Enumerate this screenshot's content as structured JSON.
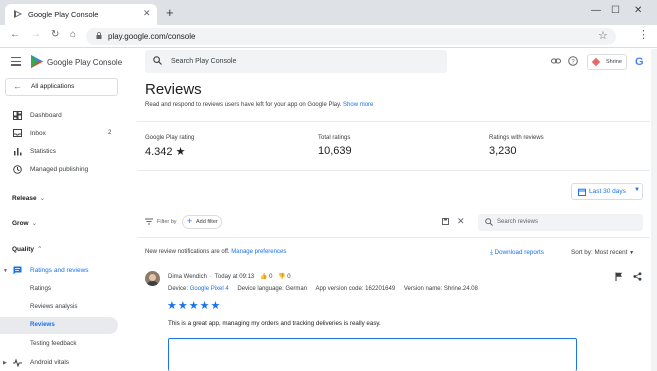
{
  "browser": {
    "tab_title": "Google Play Console",
    "url": "play.google.com/console"
  },
  "header": {
    "app_name": "Google Play Console",
    "search_placeholder": "Search Play Console",
    "app_chip": "Shrine",
    "google_logo": "G"
  },
  "sidebar": {
    "back_label": "All applications",
    "items": [
      {
        "label": "Dashboard",
        "icon": "dashboard-icon"
      },
      {
        "label": "Inbox",
        "icon": "inbox-icon",
        "count": "2"
      },
      {
        "label": "Statistics",
        "icon": "statistics-icon"
      },
      {
        "label": "Managed publishing",
        "icon": "managed-publishing-icon"
      }
    ],
    "sections": {
      "release": "Release",
      "grow": "Grow",
      "quality": "Quality"
    },
    "ratings_group": "Ratings and reviews",
    "sub_items": [
      "Ratings",
      "Reviews analysis",
      "Reviews",
      "Testing feedback"
    ],
    "android_vitals": "Android vitals"
  },
  "main": {
    "title": "Reviews",
    "description": "Read and respond to reviews users have left for your app on Google Play.",
    "show_more": "Show more",
    "stats": [
      {
        "label": "Google Play rating",
        "value": "4.342"
      },
      {
        "label": "Total ratings",
        "value": "10,639"
      },
      {
        "label": "Ratings with reviews",
        "value": "3,230"
      }
    ],
    "date_range": "Last 30 days",
    "filter_label": "Filter by",
    "add_filter": "Add filter",
    "search_reviews_placeholder": "Search reviews",
    "notice": "New review notifications are off.",
    "manage_preferences": "Manage preferences",
    "download_reports": "Download reports",
    "sort_by": "Sort by: Most recent"
  },
  "review": {
    "author": "Dima Wendich",
    "time": "Today at 09:13",
    "helpful_count": "0",
    "unhelpful_count": "0",
    "device_label": "Device:",
    "device": "Google Pixel 4",
    "language": "Device language: German",
    "app_version_code": "App version code: 162201649",
    "version_name": "Version name: Shrine.24.08",
    "stars": 5,
    "text": "This is a great app, managing my orders and tracking deliveries is really easy."
  },
  "colors": {
    "accent": "#1a73e8",
    "active_bg": "#e8eaed"
  }
}
